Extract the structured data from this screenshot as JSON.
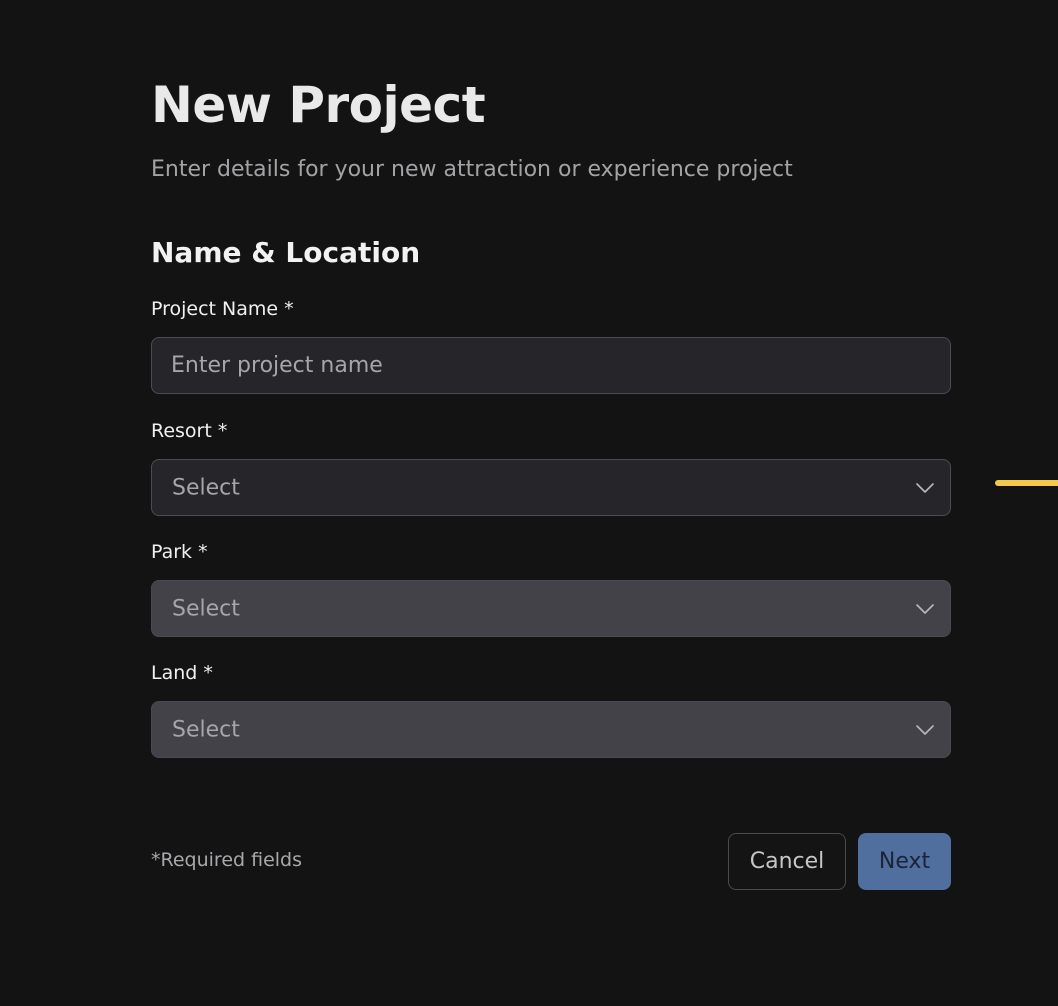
{
  "header": {
    "title": "New Project",
    "subtitle": "Enter details for your new attraction or experience project"
  },
  "section": {
    "title": "Name & Location"
  },
  "fields": {
    "project_name": {
      "label": "Project Name *",
      "placeholder": "Enter project name",
      "value": ""
    },
    "resort": {
      "label": "Resort *",
      "value": "Select",
      "icon": "chevron-down-icon"
    },
    "park": {
      "label": "Park *",
      "value": "Select",
      "icon": "chevron-down-icon",
      "disabled": true
    },
    "land": {
      "label": "Land *",
      "value": "Select",
      "icon": "chevron-down-icon",
      "disabled": true
    }
  },
  "footer": {
    "required_note": "*Required fields",
    "cancel_label": "Cancel",
    "next_label": "Next"
  },
  "colors": {
    "background": "#131313",
    "primary_button": "#506e9e",
    "indicator": "#f2c94c"
  }
}
